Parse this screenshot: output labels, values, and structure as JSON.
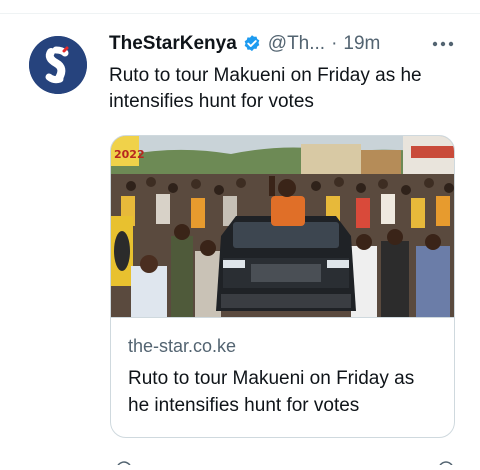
{
  "tweet": {
    "author_name": "TheStarKenya",
    "handle": "@Th...",
    "separator": "·",
    "time": "19m",
    "more_icon": "more-horizontal-icon",
    "verified_icon": "verified-badge-icon",
    "text": "Ruto to tour Makueni on Friday as he intensifies hunt for votes",
    "avatar_letter": "S"
  },
  "card": {
    "domain": "the-star.co.ke",
    "title": "Ruto to tour Makueni on Friday as he intensifies hunt for votes",
    "image_description_icon": "rally-photo",
    "sign_text": "2022"
  },
  "colors": {
    "brand_blue": "#1d9bf0",
    "avatar_bg": "#26437d",
    "secondary_text": "#536471",
    "border": "#cfd9de"
  }
}
